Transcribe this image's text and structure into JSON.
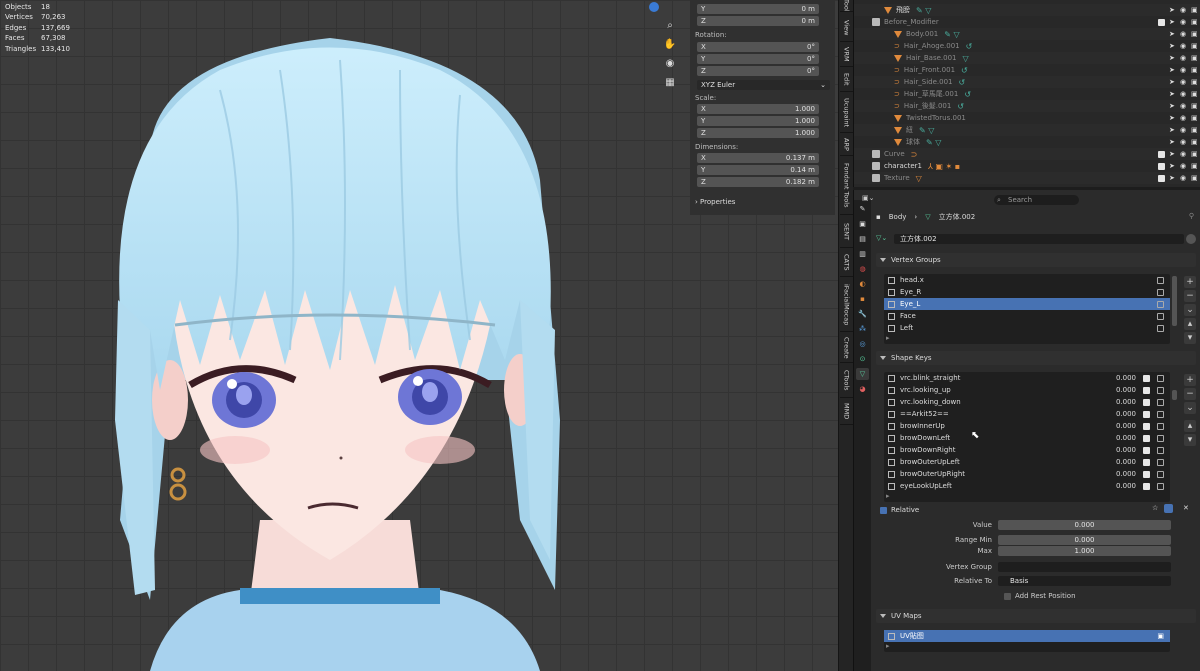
{
  "stats": [
    {
      "label": "Objects",
      "value": "18"
    },
    {
      "label": "Vertices",
      "value": "70,263"
    },
    {
      "label": "Edges",
      "value": "137,669"
    },
    {
      "label": "Faces",
      "value": "67,308"
    },
    {
      "label": "Triangles",
      "value": "133,410"
    }
  ],
  "npanel": {
    "loc_y": {
      "axis": "Y",
      "value": "0 m"
    },
    "loc_z": {
      "axis": "Z",
      "value": "0 m"
    },
    "rotation_label": "Rotation:",
    "rot": [
      {
        "axis": "X",
        "value": "0°"
      },
      {
        "axis": "Y",
        "value": "0°"
      },
      {
        "axis": "Z",
        "value": "0°"
      }
    ],
    "rot_mode": "XYZ Euler",
    "scale_label": "Scale:",
    "scale": [
      {
        "axis": "X",
        "value": "1.000"
      },
      {
        "axis": "Y",
        "value": "1.000"
      },
      {
        "axis": "Z",
        "value": "1.000"
      }
    ],
    "dim_label": "Dimensions:",
    "dims": [
      {
        "axis": "X",
        "value": "0.137 m"
      },
      {
        "axis": "Y",
        "value": "0.14 m"
      },
      {
        "axis": "Z",
        "value": "0.182 m"
      }
    ],
    "properties_label": "Properties"
  },
  "vtabs": [
    "Tool",
    "View",
    "VRM",
    "Edit",
    "Ucupaint",
    "ARP",
    "Fondant Tools",
    "SENT",
    "CATS",
    "iFacialMocap",
    "Create",
    "CTools",
    "MMD"
  ],
  "outliner": {
    "rows": [
      {
        "name": "飛膀",
        "kind": "mesh",
        "dim": false
      },
      {
        "name": "Before_Modifier",
        "kind": "collection",
        "dim": true
      },
      {
        "name": "Body.001",
        "kind": "mesh",
        "dim": true
      },
      {
        "name": "Hair_Ahoge.001",
        "kind": "curve",
        "dim": true
      },
      {
        "name": "Hair_Base.001",
        "kind": "mesh",
        "dim": true
      },
      {
        "name": "Hair_Front.001",
        "kind": "curve",
        "dim": true
      },
      {
        "name": "Hair_Side.001",
        "kind": "curve",
        "dim": true
      },
      {
        "name": "Hair_草馬尾.001",
        "kind": "curve",
        "dim": true
      },
      {
        "name": "Hair_後髮.001",
        "kind": "curve",
        "dim": true
      },
      {
        "name": "TwistedTorus.001",
        "kind": "mesh",
        "dim": true
      },
      {
        "name": "紐",
        "kind": "mesh",
        "dim": true
      },
      {
        "name": "球体",
        "kind": "mesh",
        "dim": true
      },
      {
        "name": "Curve",
        "kind": "collection",
        "dim": true
      },
      {
        "name": "character1",
        "kind": "collection",
        "dim": false
      },
      {
        "name": "Texture",
        "kind": "collection",
        "dim": true
      }
    ]
  },
  "props": {
    "search_placeholder": "Search",
    "breadcrumb_object": "Body",
    "breadcrumb_mesh": "立方体.002",
    "mesh_name": "立方体.002",
    "vertex_groups_title": "Vertex Groups",
    "vertex_groups": [
      "head.x",
      "Eye_R",
      "Eye_L",
      "Face",
      "Left"
    ],
    "shape_keys_title": "Shape Keys",
    "shape_keys": [
      {
        "name": "vrc.blink_straight",
        "value": "0.000"
      },
      {
        "name": "vrc.looking_up",
        "value": "0.000"
      },
      {
        "name": "vrc.looking_down",
        "value": "0.000"
      },
      {
        "name": "==Arkit52==",
        "value": "0.000"
      },
      {
        "name": "browInnerUp",
        "value": "0.000"
      },
      {
        "name": "browDownLeft",
        "value": "0.000"
      },
      {
        "name": "browDownRight",
        "value": "0.000"
      },
      {
        "name": "browOuterUpLeft",
        "value": "0.000"
      },
      {
        "name": "browOuterUpRight",
        "value": "0.000"
      },
      {
        "name": "eyeLookUpLeft",
        "value": "0.000"
      }
    ],
    "relative_label": "Relative",
    "value_label": "Value",
    "value": "0.000",
    "range_min_label": "Range Min",
    "range_min": "0.000",
    "max_label": "Max",
    "max": "1.000",
    "vertex_group_label": "Vertex Group",
    "relative_to_label": "Relative To",
    "relative_to": "Basis",
    "add_rest_label": "Add Rest Position",
    "uv_maps_title": "UV Maps",
    "uv_map": "UV貼图"
  },
  "colors": {
    "selection": "#4772b3",
    "hair": "#bfe4f5",
    "mesh_icon": "#e08a3c",
    "modifier_icon": "#4ab0a0"
  }
}
